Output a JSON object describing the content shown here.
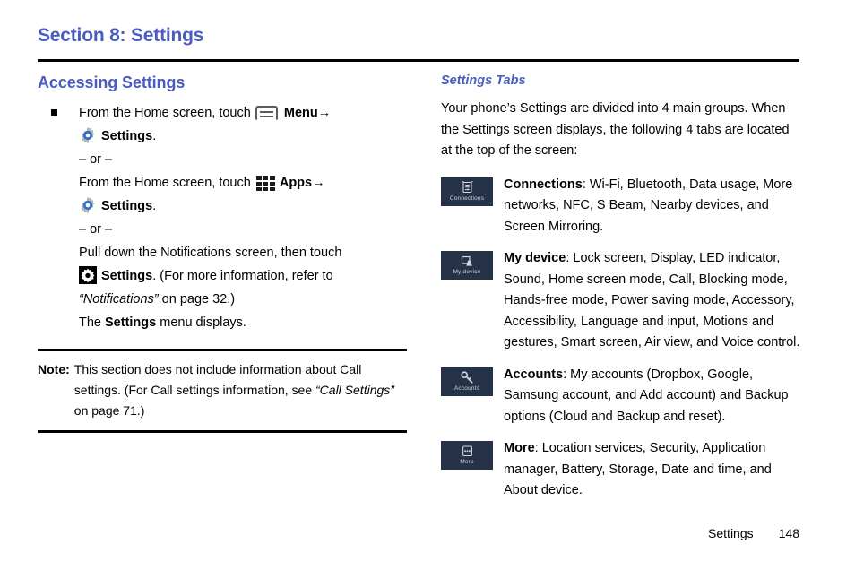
{
  "header": {
    "section_title": "Section 8: Settings"
  },
  "left": {
    "heading": "Accessing Settings",
    "step1_prefix": "From the Home screen, touch",
    "step1_menu": "Menu",
    "step1_arrow": "→",
    "step1_settings": "Settings",
    "step1_period": ".",
    "or_1": "– or –",
    "step2_prefix": "From the Home screen, touch",
    "step2_apps": "Apps",
    "step2_arrow": "→",
    "step2_settings": "Settings",
    "step2_period": ".",
    "or_2": "– or –",
    "step3_prefix": "Pull down the Notifications screen, then touch",
    "step3_settings": "Settings",
    "step3_mid": ". (For more information, refer to",
    "step3_ref": "“Notifications”",
    "step3_tail": " on page 32.)",
    "result_pre": "The ",
    "result_bold": "Settings",
    "result_post": " menu displays.",
    "note_label": "Note:",
    "note_text_1": "This section does not include information about Call settings. (For Call settings information, see ",
    "note_ref": "“Call Settings”",
    "note_text_2": " on page 71.)"
  },
  "right": {
    "heading": "Settings Tabs",
    "intro": "Your phone’s Settings are divided into 4 main groups. When the Settings screen displays, the following 4 tabs are located at the top of the screen:",
    "tabs": [
      {
        "icon_name": "connections-tab-icon",
        "caption": "Connections",
        "label": "Connections",
        "body": ": Wi-Fi, Bluetooth, Data usage, More networks, NFC, S Beam, Nearby devices, and Screen Mirroring."
      },
      {
        "icon_name": "my-device-tab-icon",
        "caption": "My device",
        "label": "My device",
        "body": ": Lock screen, Display, LED indicator, Sound, Home screen mode, Call, Blocking mode, Hands-free mode, Power saving mode, Accessory, Accessibility, Language and input, Motions and gestures, Smart screen, Air view, and Voice control."
      },
      {
        "icon_name": "accounts-tab-icon",
        "caption": "Accounts",
        "label": "Accounts",
        "body": ": My accounts (Dropbox, Google, Samsung account, and Add account) and Backup options (Cloud and Backup and reset)."
      },
      {
        "icon_name": "more-tab-icon",
        "caption": "More",
        "label": "More",
        "body": ": Location services, Security, Application manager, Battery, Storage, Date and time, and About device."
      }
    ]
  },
  "footer": {
    "label": "Settings",
    "page": "148"
  },
  "colors": {
    "heading_blue": "#4a5cc0",
    "tab_icon_bg": "#263248",
    "tab_icon_fg": "#cfd6e2",
    "rule_black": "#000000"
  }
}
